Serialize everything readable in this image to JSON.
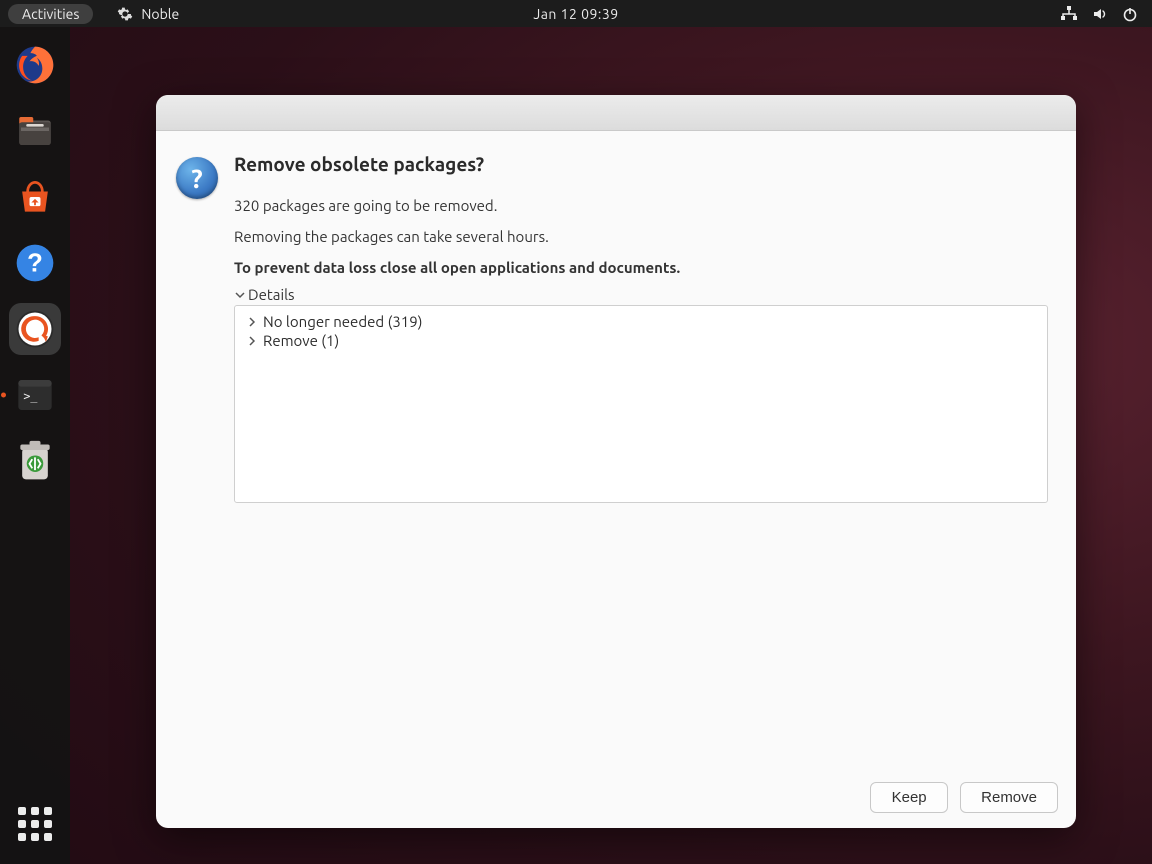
{
  "topbar": {
    "activities": "Activities",
    "app_name": "Noble",
    "clock": "Jan 12  09:39"
  },
  "dock": {
    "items": [
      {
        "name": "firefox"
      },
      {
        "name": "files"
      },
      {
        "name": "software"
      },
      {
        "name": "help"
      },
      {
        "name": "updater",
        "active": true
      },
      {
        "name": "terminal",
        "running": true
      },
      {
        "name": "trash"
      }
    ]
  },
  "dialog": {
    "title": "Remove obsolete packages?",
    "msg1": "320 packages are going to be removed.",
    "msg2": "Removing the packages can take several hours.",
    "msg3": "To prevent data loss close all open applications and documents.",
    "details_label": "Details",
    "tree": [
      "No longer needed (319)",
      "Remove (1)"
    ],
    "buttons": {
      "keep": "Keep",
      "remove": "Remove"
    }
  }
}
